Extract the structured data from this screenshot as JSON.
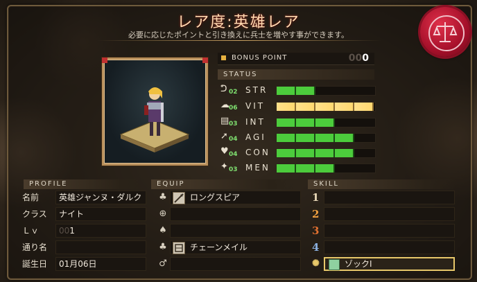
{
  "header": {
    "title": "レア度:英雄レア",
    "subtitle": "必要に応じたポイントと引き換えに兵士を増やす事ができます。",
    "seal_icon": "scales-icon"
  },
  "bonus_point": {
    "label": "BONUS POINT",
    "dim_digits": "00",
    "value": "0"
  },
  "status": {
    "header": "STATUS",
    "stats": [
      {
        "name": "STR",
        "level": "02",
        "fill": 0.4,
        "color": "#4ccc3c",
        "icon": "arm-icon"
      },
      {
        "name": "VIT",
        "level": "06",
        "fill": 1.0,
        "color": "#ffe08a",
        "icon": "cloud-icon"
      },
      {
        "name": "INT",
        "level": "03",
        "fill": 0.6,
        "color": "#4ccc3c",
        "icon": "book-icon"
      },
      {
        "name": "AGI",
        "level": "04",
        "fill": 0.8,
        "color": "#4ccc3c",
        "icon": "running-icon"
      },
      {
        "name": "CON",
        "level": "04",
        "fill": 0.8,
        "color": "#4ccc3c",
        "icon": "heart-icon"
      },
      {
        "name": "MEN",
        "level": "03",
        "fill": 0.6,
        "color": "#4ccc3c",
        "icon": "spirit-icon"
      }
    ]
  },
  "profile": {
    "header": "PROFILE",
    "rows": [
      {
        "label": "名前",
        "value": "英雄ジャンヌ・ダルク",
        "dim": ""
      },
      {
        "label": "クラス",
        "value": "ナイト",
        "dim": ""
      },
      {
        "label": "Ｌｖ",
        "value": "1",
        "dim": "00"
      },
      {
        "label": "通り名",
        "value": "",
        "dim": ""
      },
      {
        "label": "誕生日",
        "value": "01月06日",
        "dim": ""
      }
    ]
  },
  "equip": {
    "header": "EQUIP",
    "slots": [
      {
        "icon": "weapon-slot-icon",
        "glyph": "♣",
        "item": "ロングスピア",
        "item_icon": "spear-icon"
      },
      {
        "icon": "shield-slot-icon",
        "glyph": "⊕",
        "item": "",
        "item_icon": ""
      },
      {
        "icon": "helmet-slot-icon",
        "glyph": "♠",
        "item": "",
        "item_icon": ""
      },
      {
        "icon": "armor-slot-icon",
        "glyph": "♣",
        "item": "チェーンメイル",
        "item_icon": "chainmail-icon"
      },
      {
        "icon": "accessory-slot-icon",
        "glyph": "♂",
        "item": "",
        "item_icon": ""
      }
    ]
  },
  "skill": {
    "header": "SKILL",
    "slots": [
      {
        "number": "1",
        "color": "#e8d8b8",
        "name": ""
      },
      {
        "number": "2",
        "color": "#f0a040",
        "name": ""
      },
      {
        "number": "3",
        "color": "#e07030",
        "name": ""
      },
      {
        "number": "4",
        "color": "#8ab0e0",
        "name": ""
      },
      {
        "number": "",
        "color": "#e8c86a",
        "name": "ゾックⅠ",
        "active": true,
        "icon": "sun-icon"
      }
    ]
  }
}
